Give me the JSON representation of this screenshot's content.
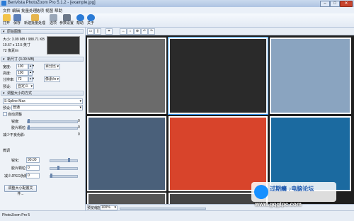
{
  "window": {
    "title": "BenVista PhotoZoom Pro 5.1.2 - [example.jpg]",
    "minimize": "–",
    "maximize": "□",
    "close": "✕"
  },
  "menu": [
    "文件",
    "编辑",
    "批量处理",
    "选项",
    "视图",
    "帮助"
  ],
  "toolbar": {
    "items": [
      "打开",
      "保存",
      "新建批量处理",
      "选项",
      "参数设置",
      "帮助",
      "关于"
    ]
  },
  "left_panel": {
    "original_section": "原始图像",
    "original_info": [
      "大小: 3.09 MB / 988.71 KB",
      "10.67 x 12.5 英寸",
      "72 像素/in"
    ],
    "new_size_section": "新尺寸 (3.09 MB)",
    "width_label": "宽度:",
    "width_value": "100",
    "width_unit": "百分比",
    "height_label": "高度:",
    "height_value": "100",
    "resolution_label": "分辨率:",
    "resolution_value": "72",
    "resolution_unit": "像素/in",
    "preset_label": "预设:",
    "preset_value": "自定义",
    "method_section": "调整大小的方式",
    "method_value": "S-Spline Max",
    "preset2_label": "预设:",
    "preset2_value": "普通",
    "advanced_label": "自动调整",
    "sharpness_label": "锐度:",
    "sharpness_value": "0",
    "film_grain_label": "胶片颗粒:",
    "film_grain_value": "0",
    "artifact_label": "减少不良伪影:",
    "artifact_value": "0",
    "sliders_header": "微调",
    "slider_values": [
      "90.00",
      "0",
      "0"
    ],
    "slider_labels": [
      "锐化:",
      "胶片颗粒:",
      "减少JPEG伪影:"
    ],
    "button_label": "调整大小配置文件..."
  },
  "viewer": {
    "zoom_label": "预览缩放",
    "zoom_value": "100%"
  },
  "status": {
    "text": "PhotoZoom Pro 5"
  },
  "watermark": {
    "title": "过期癵 ♪电脑论坛",
    "url": "www.gqgtpc.com"
  },
  "icons": {
    "open": "folder-icon",
    "save": "save-icon",
    "batch": "batch-icon",
    "options": "gear-icon",
    "prefs": "tools-icon",
    "help": "help-icon",
    "about": "info-icon"
  },
  "colors": {
    "accent": "#2b7bd6",
    "watermark_blue": "#1790ff"
  }
}
